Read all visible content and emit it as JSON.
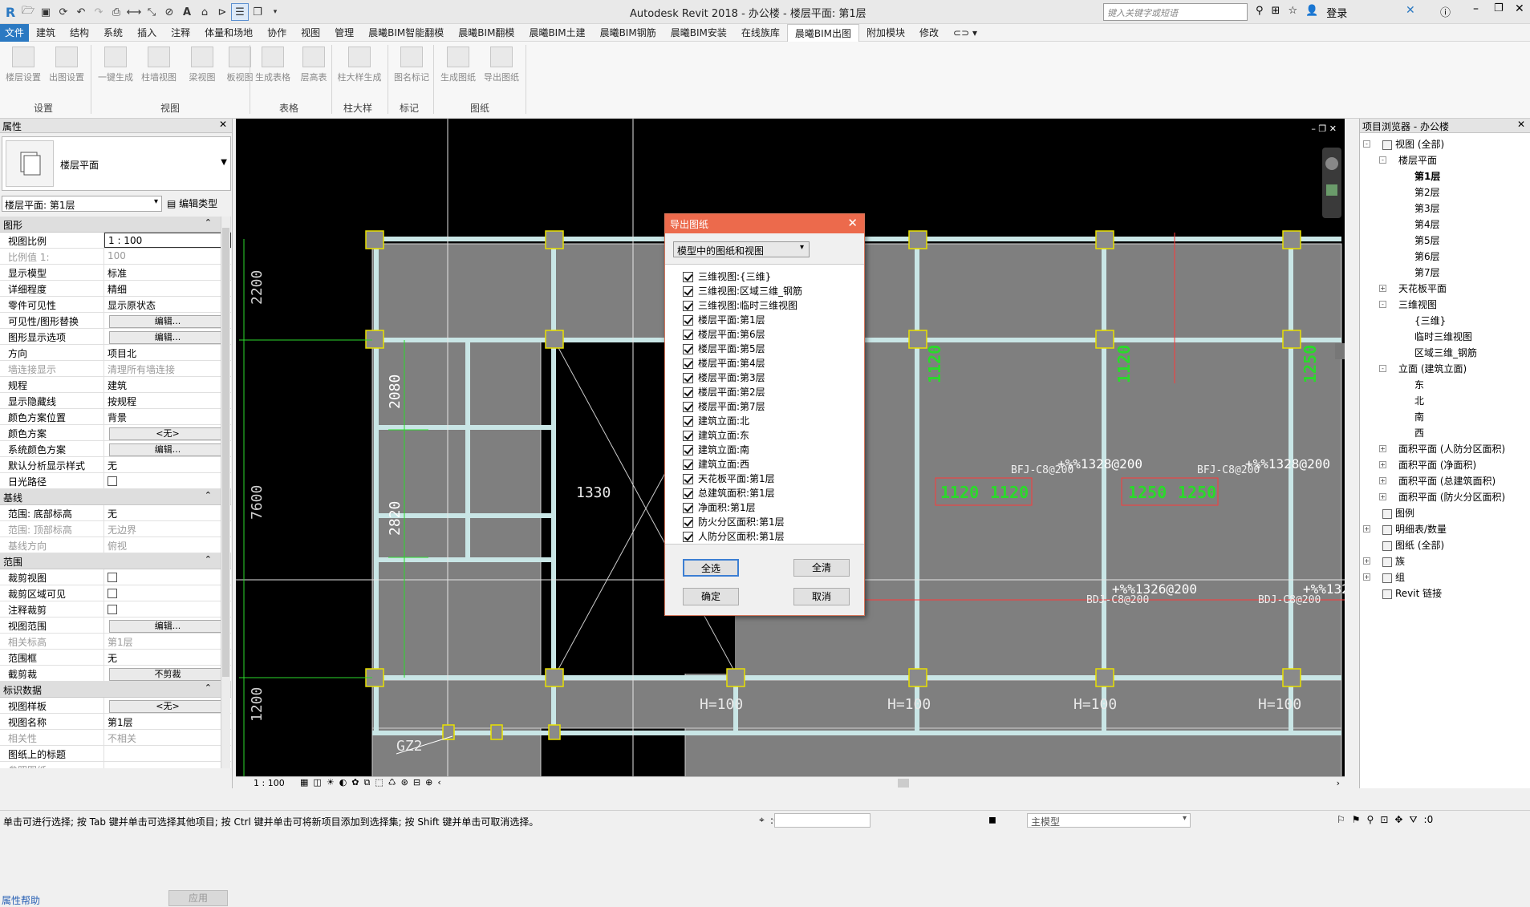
{
  "app": {
    "title": "Autodesk Revit 2018 -    办公楼 - 楼层平面: 第1层",
    "search_placeholder": "键入关键字或短语",
    "login": "登录"
  },
  "menu": [
    "文件",
    "建筑",
    "结构",
    "系统",
    "插入",
    "注释",
    "体量和场地",
    "协作",
    "视图",
    "管理",
    "晨曦BIM智能翻模",
    "晨曦BIM翻模",
    "晨曦BIM土建",
    "晨曦BIM钢筋",
    "晨曦BIM安装",
    "在线族库",
    "晨曦BIM出图",
    "附加模块",
    "修改"
  ],
  "menu_active_index": 16,
  "ribbon": {
    "buttons": [
      "楼层设置",
      "出图设置",
      "一键生成",
      "柱墙视图",
      "梁视图",
      "板视图",
      "生成表格",
      "层高表",
      "柱大样生成",
      "图名标记",
      "生成图纸",
      "导出图纸"
    ],
    "groups": [
      "设置",
      "视图",
      "表格",
      "柱大样",
      "标记",
      "图纸"
    ]
  },
  "properties": {
    "title": "属性",
    "type_name": "楼层平面",
    "view_selector": "楼层平面: 第1层",
    "edit_type": "编辑类型",
    "sections": [
      {
        "name": "图形",
        "rows": [
          {
            "k": "视图比例",
            "v": "1 : 100",
            "input": true
          },
          {
            "k": "比例值 1:",
            "v": "100",
            "dim": true
          },
          {
            "k": "显示模型",
            "v": "标准"
          },
          {
            "k": "详细程度",
            "v": "精细"
          },
          {
            "k": "零件可见性",
            "v": "显示原状态"
          },
          {
            "k": "可见性/图形替换",
            "v": "编辑...",
            "btn": true
          },
          {
            "k": "图形显示选项",
            "v": "编辑...",
            "btn": true
          },
          {
            "k": "方向",
            "v": "项目北"
          },
          {
            "k": "墙连接显示",
            "v": "清理所有墙连接",
            "dim": true
          },
          {
            "k": "规程",
            "v": "建筑"
          },
          {
            "k": "显示隐藏线",
            "v": "按规程"
          },
          {
            "k": "颜色方案位置",
            "v": "背景"
          },
          {
            "k": "颜色方案",
            "v": "<无>",
            "btn": true
          },
          {
            "k": "系统颜色方案",
            "v": "编辑...",
            "btn": true
          },
          {
            "k": "默认分析显示样式",
            "v": "无"
          },
          {
            "k": "日光路径",
            "v": "",
            "cb": true
          }
        ]
      },
      {
        "name": "基线",
        "rows": [
          {
            "k": "范围: 底部标高",
            "v": "无"
          },
          {
            "k": "范围: 顶部标高",
            "v": "无边界",
            "dim": true
          },
          {
            "k": "基线方向",
            "v": "俯视",
            "dim": true
          }
        ]
      },
      {
        "name": "范围",
        "rows": [
          {
            "k": "裁剪视图",
            "v": "",
            "cb": true
          },
          {
            "k": "裁剪区域可见",
            "v": "",
            "cb": true
          },
          {
            "k": "注释裁剪",
            "v": "",
            "cb": true
          },
          {
            "k": "视图范围",
            "v": "编辑...",
            "btn": true
          },
          {
            "k": "相关标高",
            "v": "第1层",
            "dim": true
          },
          {
            "k": "范围框",
            "v": "无"
          },
          {
            "k": "截剪裁",
            "v": "不剪裁",
            "btn": true
          }
        ]
      },
      {
        "name": "标识数据",
        "rows": [
          {
            "k": "视图样板",
            "v": "<无>",
            "btn": true
          },
          {
            "k": "视图名称",
            "v": "第1层"
          },
          {
            "k": "相关性",
            "v": "不相关",
            "dim": true
          },
          {
            "k": "图纸上的标题",
            "v": ""
          },
          {
            "k": "参照图纸",
            "v": "",
            "dim": true
          }
        ]
      }
    ],
    "help": "属性帮助",
    "apply": "应用"
  },
  "browser": {
    "title": "项目浏览器 - 办公楼",
    "items": [
      {
        "label": "视图 (全部)",
        "level": 0,
        "exp": "-",
        "icon": true
      },
      {
        "label": "楼层平面",
        "level": 1,
        "exp": "-"
      },
      {
        "label": "第1层",
        "level": 2,
        "bold": true
      },
      {
        "label": "第2层",
        "level": 2
      },
      {
        "label": "第3层",
        "level": 2
      },
      {
        "label": "第4层",
        "level": 2
      },
      {
        "label": "第5层",
        "level": 2
      },
      {
        "label": "第6层",
        "level": 2
      },
      {
        "label": "第7层",
        "level": 2
      },
      {
        "label": "天花板平面",
        "level": 1,
        "exp": "+"
      },
      {
        "label": "三维视图",
        "level": 1,
        "exp": "-"
      },
      {
        "label": "{三维}",
        "level": 2
      },
      {
        "label": "临时三维视图",
        "level": 2
      },
      {
        "label": "区域三维_钢筋",
        "level": 2
      },
      {
        "label": "立面 (建筑立面)",
        "level": 1,
        "exp": "-"
      },
      {
        "label": "东",
        "level": 2
      },
      {
        "label": "北",
        "level": 2
      },
      {
        "label": "南",
        "level": 2
      },
      {
        "label": "西",
        "level": 2
      },
      {
        "label": "面积平面 (人防分区面积)",
        "level": 1,
        "exp": "+"
      },
      {
        "label": "面积平面 (净面积)",
        "level": 1,
        "exp": "+"
      },
      {
        "label": "面积平面 (总建筑面积)",
        "level": 1,
        "exp": "+"
      },
      {
        "label": "面积平面 (防火分区面积)",
        "level": 1,
        "exp": "+"
      },
      {
        "label": "图例",
        "level": 0,
        "icon": true
      },
      {
        "label": "明细表/数量",
        "level": 0,
        "exp": "+",
        "icon": true
      },
      {
        "label": "图纸 (全部)",
        "level": 0,
        "icon": true
      },
      {
        "label": "族",
        "level": 0,
        "exp": "+",
        "icon": true
      },
      {
        "label": "组",
        "level": 0,
        "exp": "+",
        "icon": true
      },
      {
        "label": "Revit 链接",
        "level": 0,
        "icon": true
      }
    ]
  },
  "dialog": {
    "title": "导出图纸",
    "select": "模型中的图纸和视图",
    "items": [
      "三维视图:{三维}",
      "三维视图:区域三维_钢筋",
      "三维视图:临时三维视图",
      "楼层平面:第1层",
      "楼层平面:第6层",
      "楼层平面:第5层",
      "楼层平面:第4层",
      "楼层平面:第3层",
      "楼层平面:第2层",
      "楼层平面:第7层",
      "建筑立面:北",
      "建筑立面:东",
      "建筑立面:南",
      "建筑立面:西",
      "天花板平面:第1层",
      "总建筑面积:第1层",
      "净面积:第1层",
      "防火分区面积:第1层",
      "人防分区面积:第1层"
    ],
    "select_all": "全选",
    "clear_all": "全清",
    "ok": "确定",
    "cancel": "取消"
  },
  "drawing": {
    "dims_left": [
      "2200",
      "7600",
      "1200"
    ],
    "dims_inner": [
      "2080",
      "2820"
    ],
    "tags_green": [
      "1120",
      "1120",
      "1250"
    ],
    "labels": {
      "gz": "GZ2",
      "b1330": "1330",
      "h100": "H=100",
      "beam1": "BFJ-C8@200",
      "beam2": "BDJ-C8@200",
      "rebar1": "+%%1328@200",
      "rebar2": "+%%1326@200"
    },
    "boxes": [
      "1120",
      "1120",
      "1250",
      "1250"
    ]
  },
  "viewstatus": {
    "scale": "1 : 100"
  },
  "statusbar": {
    "text": "单击可进行选择; 按 Tab 键并单击可选择其他项目; 按 Ctrl 键并单击可将新项目添加到选择集; 按 Shift 键并单击可取消选择。",
    "coord": ":0",
    "model": "主模型",
    "filter": ":0"
  }
}
